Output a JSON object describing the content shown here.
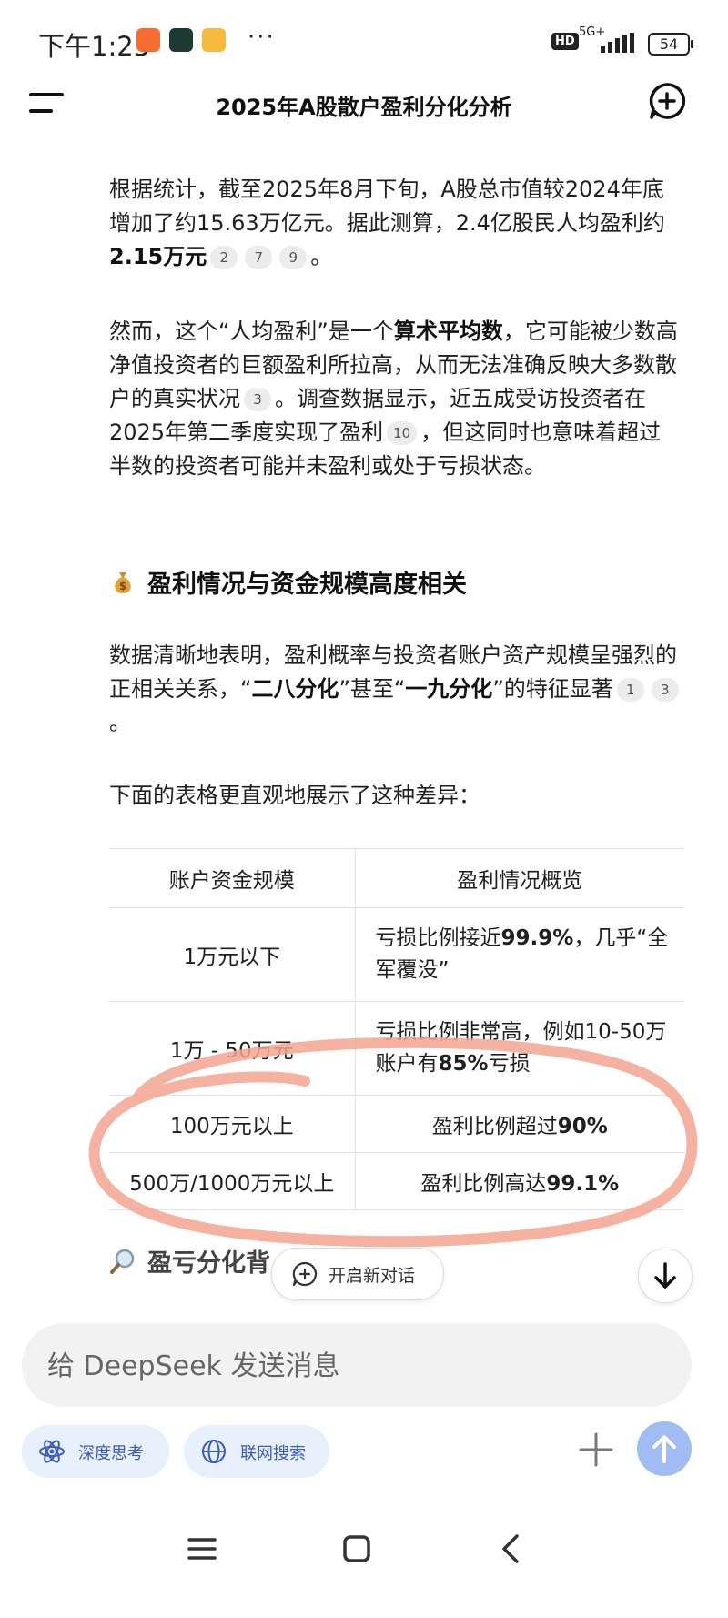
{
  "status_bar": {
    "time": "下午1:25",
    "hd": "HD",
    "network": "5G+",
    "battery": "54",
    "more": "···"
  },
  "header": {
    "title": "2025年A股散户盈利分化分析"
  },
  "paragraphs": {
    "p1": {
      "text1": "根据统计，截至2025年8月下旬，A股总市值较2024年底增加了约15.63万亿元。据此测算，2.4亿股民人均盈利约",
      "bold1": "2.15万元",
      "cites": [
        "2",
        "7",
        "9"
      ],
      "end": "。"
    },
    "p2": {
      "text1": "然而，这个“人均盈利”是一个",
      "bold1": "算术平均数",
      "text2": "，它可能被少数高净值投资者的巨额盈利所拉高，从而无法准确反映大多数散户的真实状况",
      "cite1": "3",
      "text3": "。调查数据显示，近五成受访投资者在2025年第二季度实现了盈利",
      "cite2": "10",
      "text4": "，但这同时也意味着超过半数的投资者可能并未盈利或处于亏损状态。"
    },
    "p4": {
      "text1": "数据清晰地表明，盈利概率与投资者账户资产规模呈强烈的正相关关系，“",
      "bold1": "二八分化",
      "text2": "”甚至“",
      "bold2": "一九分化",
      "text3": "”的特征显著",
      "cites": [
        "1",
        "3"
      ],
      "end": "。"
    },
    "p5": {
      "text": "下面的表格更直观地展示了这种差异："
    }
  },
  "section_heading": {
    "text": "盈利情况与资金规模高度相关"
  },
  "table": {
    "headers": [
      "账户资金规模",
      "盈利情况概览"
    ],
    "rows": [
      {
        "scale": "1万元以下",
        "pre": "亏损比例接近",
        "bold": "99.9%",
        "post": "，几乎“全军覆没”"
      },
      {
        "scale": "1万 - 50万元",
        "pre": "亏损比例非常高，例如10-50万账户有",
        "bold": "85%",
        "post": "亏损"
      },
      {
        "scale": "100万元以上",
        "pre": "盈利比例超过",
        "bold": "90%",
        "post": ""
      },
      {
        "scale": "500万/1000万元以上",
        "pre": "盈利比例高达",
        "bold": "99.1%",
        "post": ""
      }
    ]
  },
  "next_heading": {
    "text": "盈亏分化背"
  },
  "floating": {
    "new_conversation": "开启新对话"
  },
  "composer": {
    "placeholder": "给 DeepSeek 发送消息",
    "deep_think": "深度思考",
    "web_search": "联网搜索"
  },
  "colors": {
    "accent": "#3b5bbf",
    "chip_bg": "#e8f0fb",
    "send_btn": "#9fbdf3",
    "highlight_ring": "#f4a58f"
  }
}
